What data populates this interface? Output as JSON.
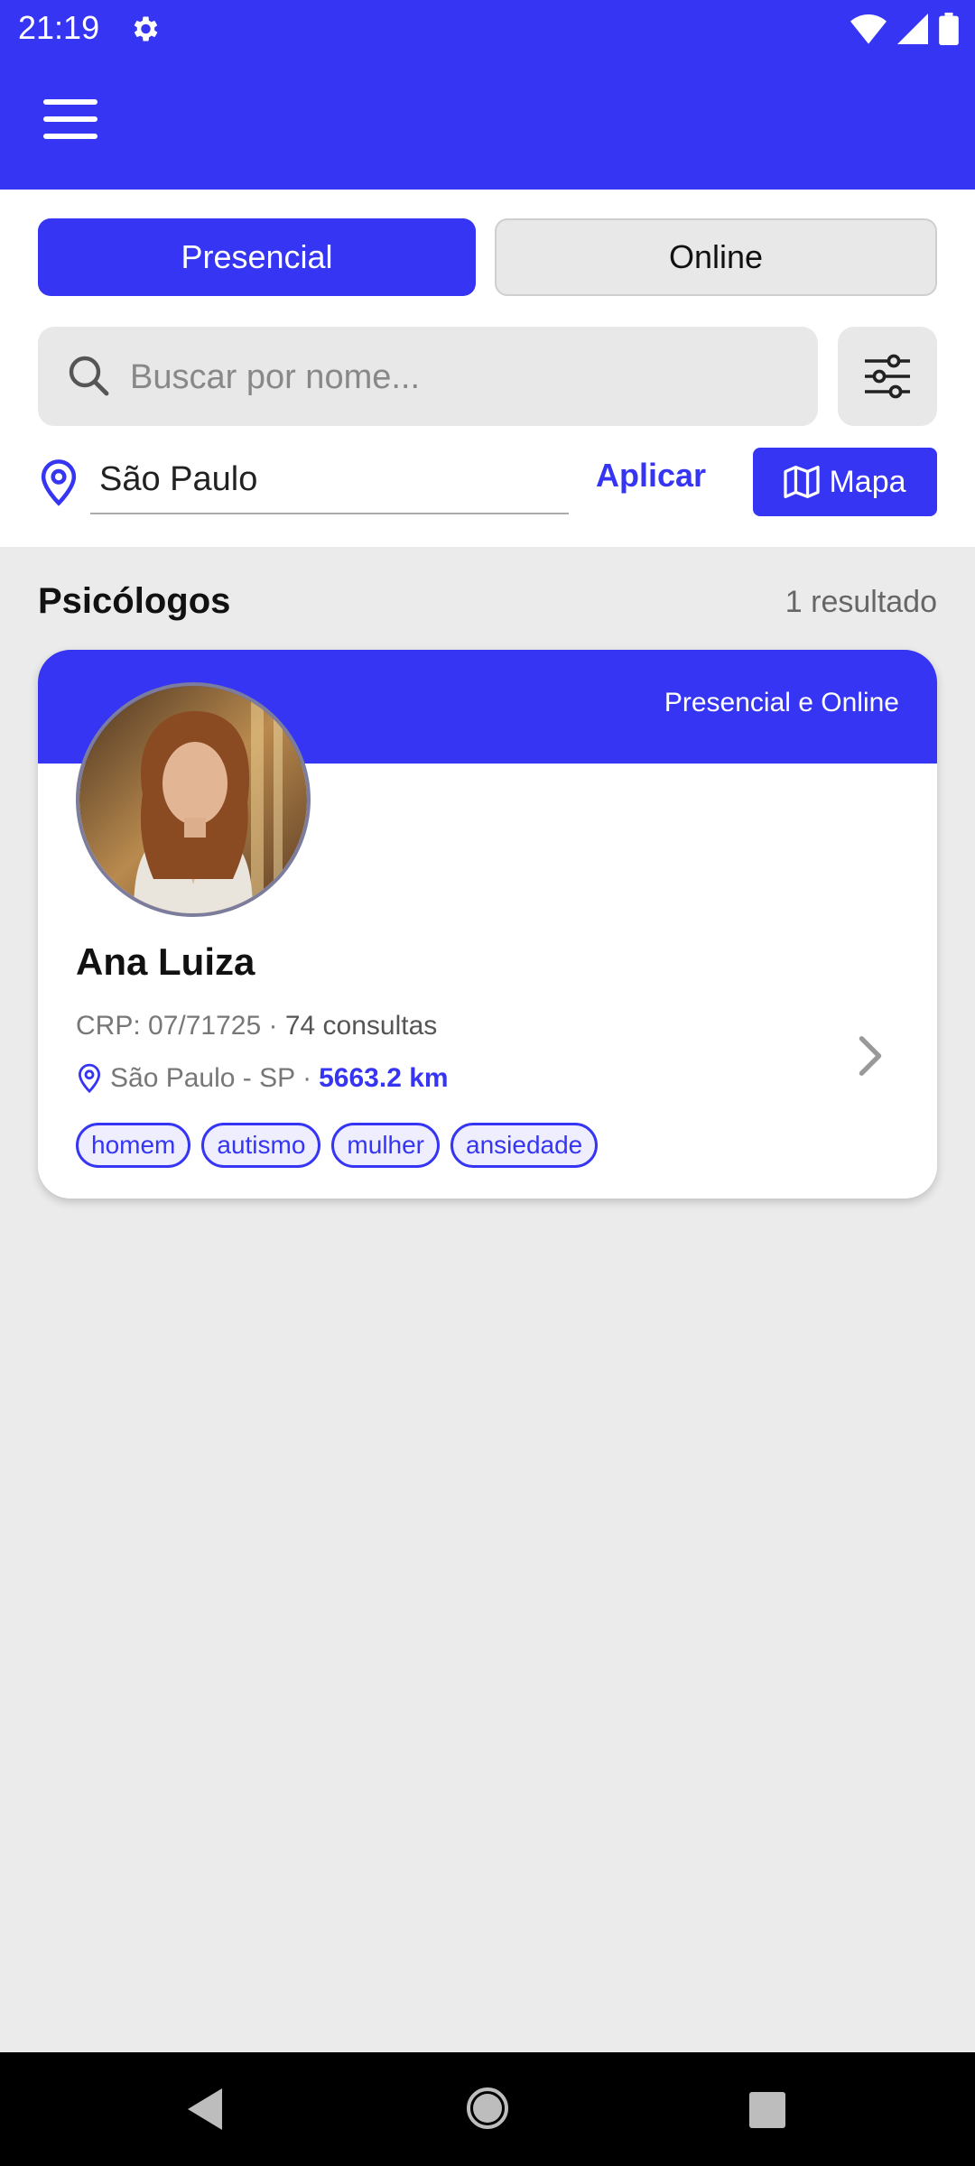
{
  "status_bar": {
    "time": "21:19",
    "gear_icon": "gear-icon",
    "wifi_icon": "wifi-icon",
    "signal_icon": "signal-icon",
    "battery_icon": "battery-icon"
  },
  "app_bar": {
    "menu_icon": "hamburger-menu-icon"
  },
  "mode_tabs": [
    {
      "label": "Presencial",
      "active": true
    },
    {
      "label": "Online",
      "active": false
    }
  ],
  "search": {
    "placeholder": "Buscar por nome...",
    "value": ""
  },
  "filter_icon": "sliders-icon",
  "location": {
    "value": "São Paulo",
    "apply_label": "Aplicar",
    "map_label": "Mapa"
  },
  "results": {
    "title": "Psicólogos",
    "count_label": "1 resultado",
    "cards": [
      {
        "badge": "Presencial e Online",
        "name": "Ana Luiza",
        "crp": "CRP: 07/71725",
        "separator": "·",
        "consultations": "74 consultas",
        "location": "São Paulo - SP",
        "distance": "5663.2 km",
        "tags": [
          "homem",
          "autismo",
          "mulher",
          "ansiedade"
        ]
      }
    ]
  },
  "colors": {
    "primary": "#3535f3",
    "background": "#ebebeb",
    "surface": "#ffffff"
  }
}
